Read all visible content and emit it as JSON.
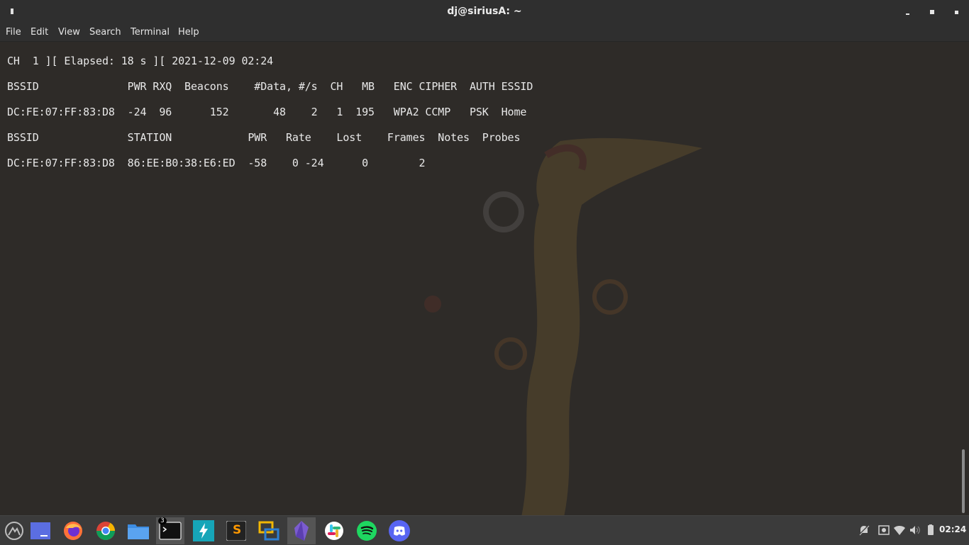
{
  "window": {
    "title": "dj@siriusA: ~",
    "controls": [
      "minimize",
      "maximize",
      "close"
    ]
  },
  "menu": [
    "File",
    "Edit",
    "View",
    "Search",
    "Terminal",
    "Help"
  ],
  "terminal": {
    "lines": [
      "CH  1 ][ Elapsed: 18 s ][ 2021-12-09 02:24",
      "BSSID              PWR RXQ  Beacons    #Data, #/s  CH   MB   ENC CIPHER  AUTH ESSID",
      "DC:FE:07:FF:83:D8  -24  96      152       48    2   1  195   WPA2 CCMP   PSK  Home",
      "BSSID              STATION            PWR   Rate    Lost    Frames  Notes  Probes",
      "DC:FE:07:FF:83:D8  86:EE:B0:38:E6:ED  -58    0 -24      0        2"
    ]
  },
  "taskbar": {
    "apps": [
      {
        "name": "menu-icon"
      },
      {
        "name": "desktop-icon"
      },
      {
        "name": "firefox-icon"
      },
      {
        "name": "chrome-icon"
      },
      {
        "name": "files-icon"
      },
      {
        "name": "terminal-icon",
        "badge": "3"
      },
      {
        "name": "bolt-icon"
      },
      {
        "name": "sublime-icon",
        "letter": "S"
      },
      {
        "name": "virtualbox-icon"
      },
      {
        "name": "crystal-icon"
      },
      {
        "name": "slack-icon"
      },
      {
        "name": "spotify-icon"
      },
      {
        "name": "discord-icon"
      }
    ],
    "tray": [
      "notifications-off-icon",
      "screenshot-icon",
      "wifi-icon",
      "volume-icon",
      "battery-icon"
    ],
    "clock": "02:24"
  },
  "colors": {
    "terminal_bg": "#2e2b28",
    "text": "#e8e8e8",
    "titlebar": "#2f2f2f",
    "taskbar": "#3b3b3b"
  }
}
